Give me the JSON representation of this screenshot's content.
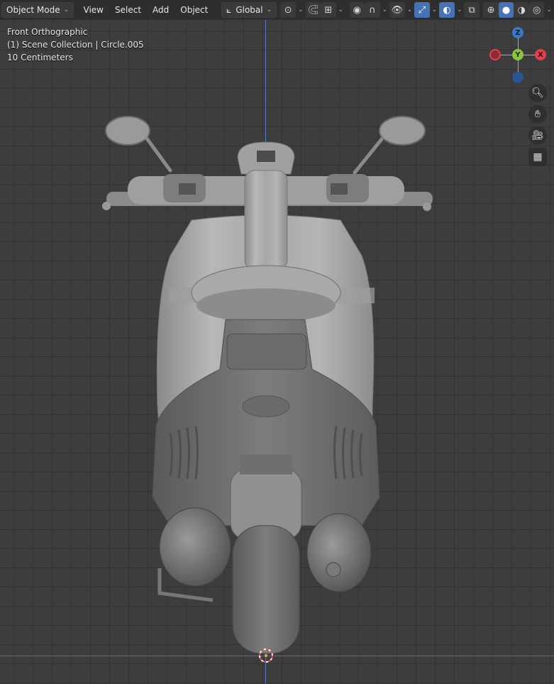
{
  "header": {
    "mode_label": "Object Mode",
    "menus": [
      "View",
      "Select",
      "Add",
      "Object"
    ],
    "orientation_label": "Global"
  },
  "overlay": {
    "view_name": "Front Orthographic",
    "collection": "(1) Scene Collection | Circle.005",
    "scale": "10 Centimeters"
  },
  "gizmo": {
    "z_label": "Z",
    "y_label": "Y",
    "x_label": "X",
    "z_color": "#3b78c9",
    "y_color": "#8bc53f",
    "x_color": "#e0414f"
  },
  "nav_icons": [
    "zoom-icon",
    "hand-pan-icon",
    "camera-icon",
    "grid-icon"
  ],
  "colors": {
    "header_bg": "#2e2e2e",
    "viewport_bg": "#3d3d3d",
    "accent": "#4772b3"
  }
}
